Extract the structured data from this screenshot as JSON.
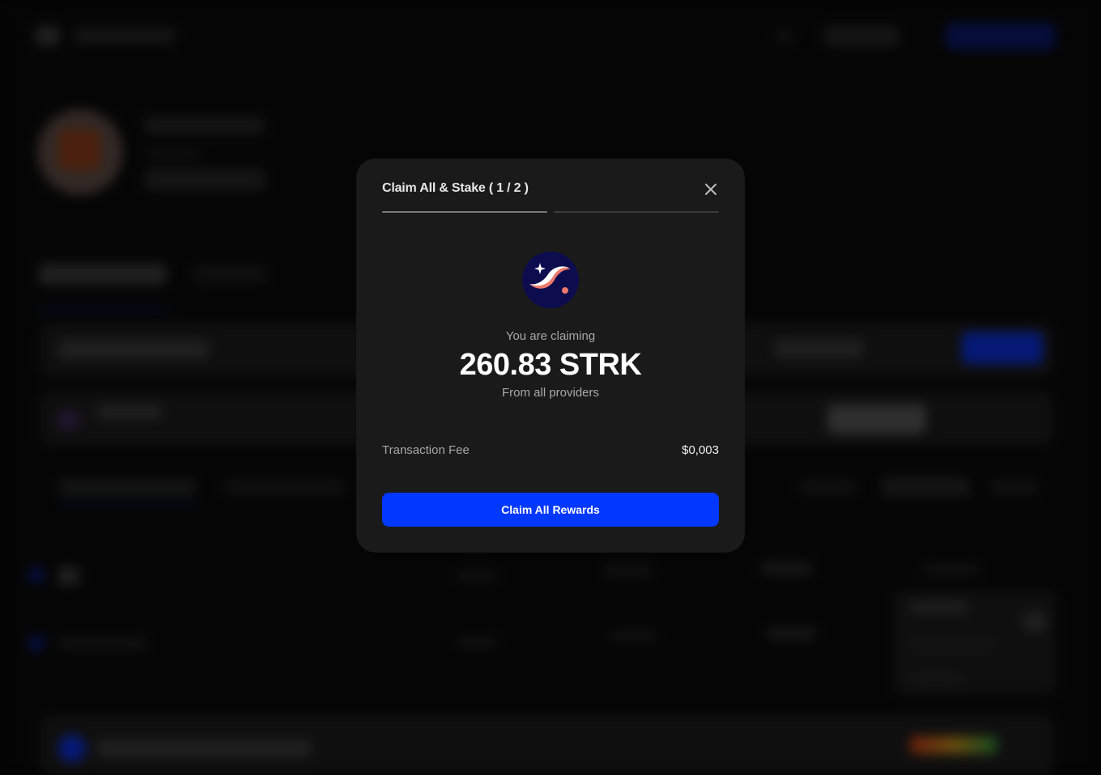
{
  "modal": {
    "title": "Claim All & Stake ( 1 / 2 )",
    "steps": [
      {
        "state": "active",
        "color": "#7a7a7a"
      },
      {
        "state": "inactive",
        "color": "#3a3a3a"
      }
    ],
    "token_icon": "starknet-logo-icon",
    "claim_caption": "You are claiming",
    "claim_amount": "260.83 STRK",
    "claim_source": "From all providers",
    "fee_label": "Transaction Fee",
    "fee_value": "$0,003",
    "claim_button_label": "Claim All Rewards",
    "close_icon": "close-icon"
  },
  "colors": {
    "modal_bg": "#1a1a1a",
    "accent": "#0038ff",
    "logo_bg": "#0c0c4f",
    "logo_pink": "#ec796b"
  }
}
